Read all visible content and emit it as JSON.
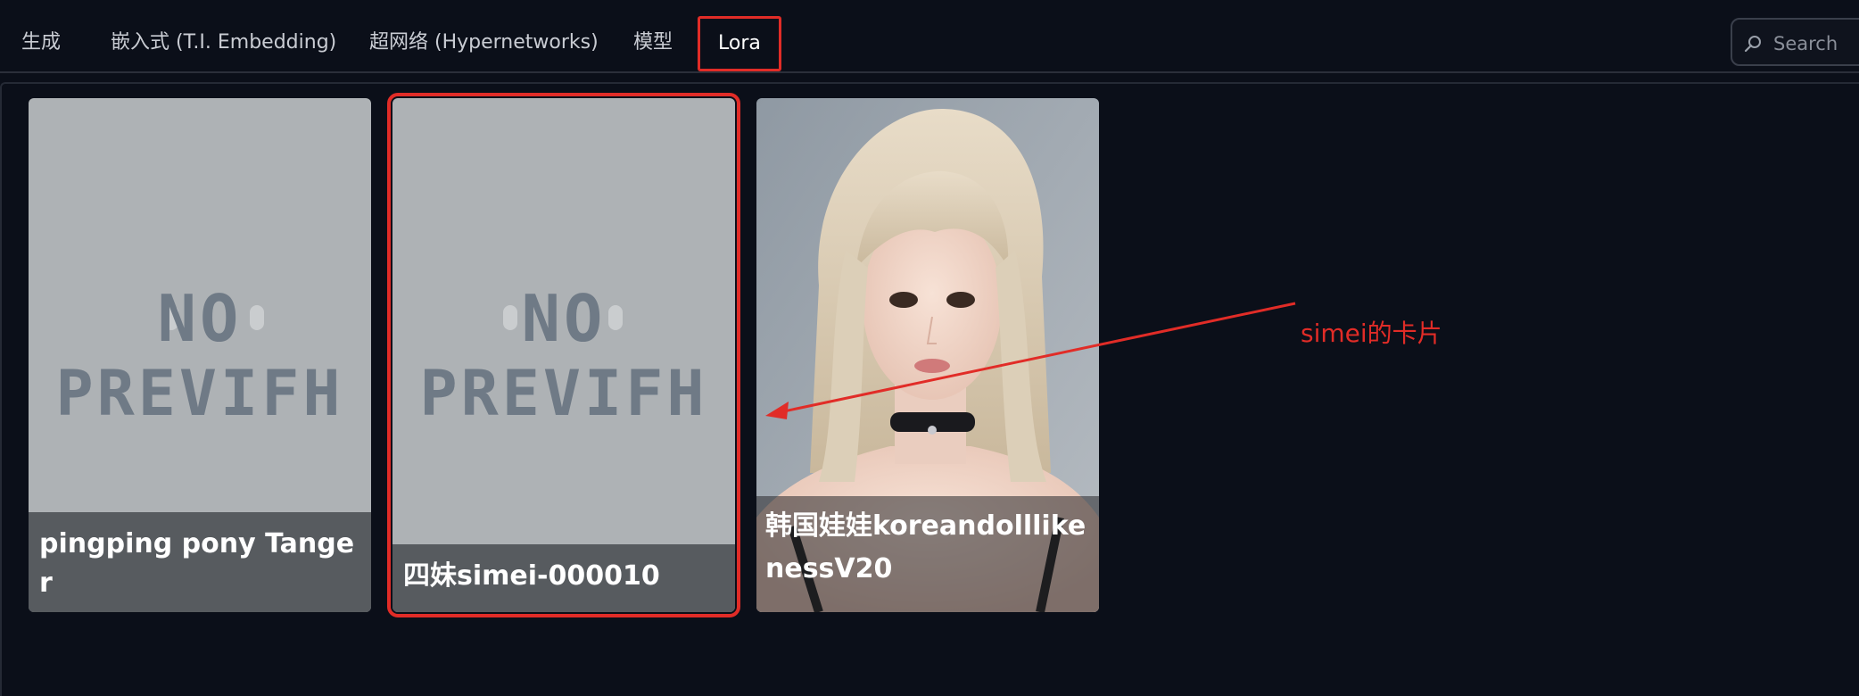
{
  "tabs": [
    {
      "label": "生成"
    },
    {
      "label": "嵌入式 (T.I. Embedding)"
    },
    {
      "label": "超网络 (Hypernetworks)"
    },
    {
      "label": "模型"
    },
    {
      "label": "Lora"
    }
  ],
  "active_tab": "Lora",
  "search": {
    "placeholder": "Search",
    "value": ""
  },
  "cards": [
    {
      "title": "pingping pony Tanger",
      "preview": "NO PREVIEW",
      "preview_line1": "NO",
      "preview_line2": "PREVIFH"
    },
    {
      "title": "四妹simei-000010",
      "preview": "NO PREVIEW",
      "preview_line1": "NO",
      "preview_line2": "PREVIFH"
    },
    {
      "title": "韩国娃娃koreandolllikenessV20",
      "preview": "image"
    }
  ],
  "annotation": {
    "text": "simei的卡片",
    "color": "#e12c27"
  },
  "colors": {
    "background": "#0b0f19",
    "highlight": "#e12c27",
    "card_placeholder": "#aeb2b5"
  }
}
